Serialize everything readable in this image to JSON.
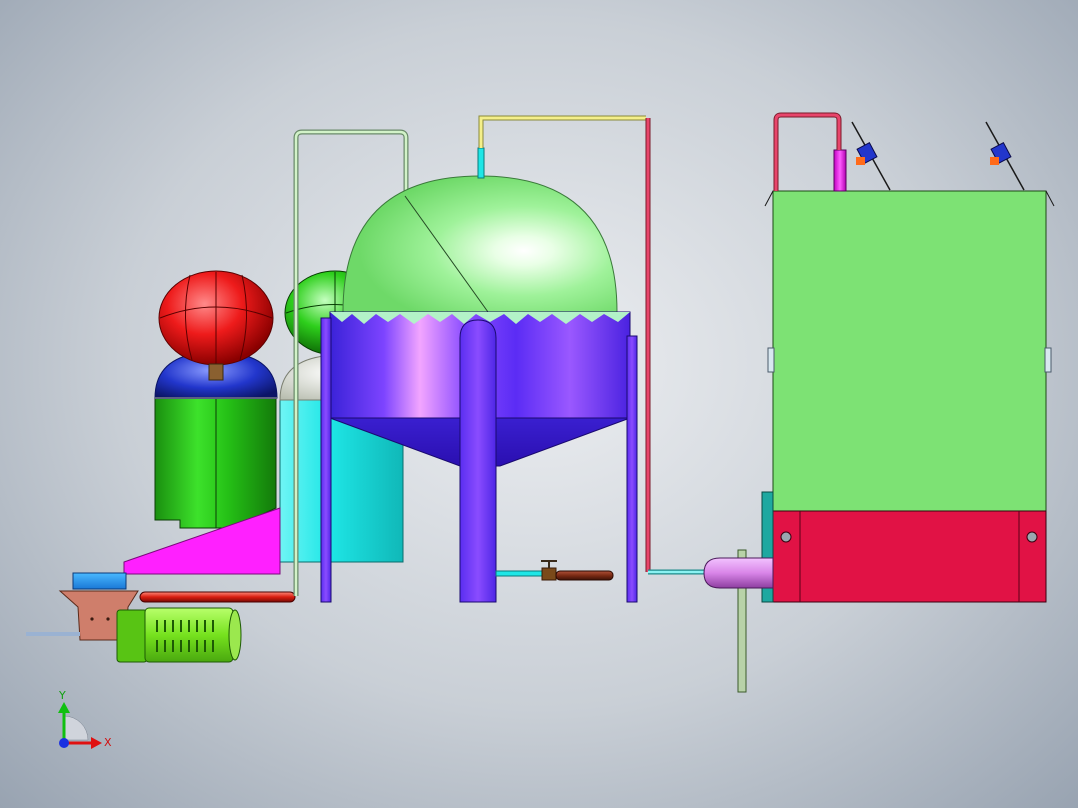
{
  "colors": {
    "bg_center": "#eceef1",
    "bg_edge": "#98a3b1",
    "green": "#33d11a",
    "red": "#ee1b1b",
    "blue": "#2236cc",
    "cyan": "#1ee6e6",
    "magenta": "#ff20ff",
    "violet": "#7a33ff",
    "light_green": "#8ff08a",
    "box_green": "#7de274",
    "crimson": "#e11245",
    "salmon": "#cf7e6b",
    "orchid": "#d985e8",
    "brown": "#7a2a14",
    "yellow_pipe": "#f4ef8a",
    "pink_pipe": "#e8456b"
  },
  "axis_triad": {
    "x_label": "X",
    "y_label": "Y"
  }
}
